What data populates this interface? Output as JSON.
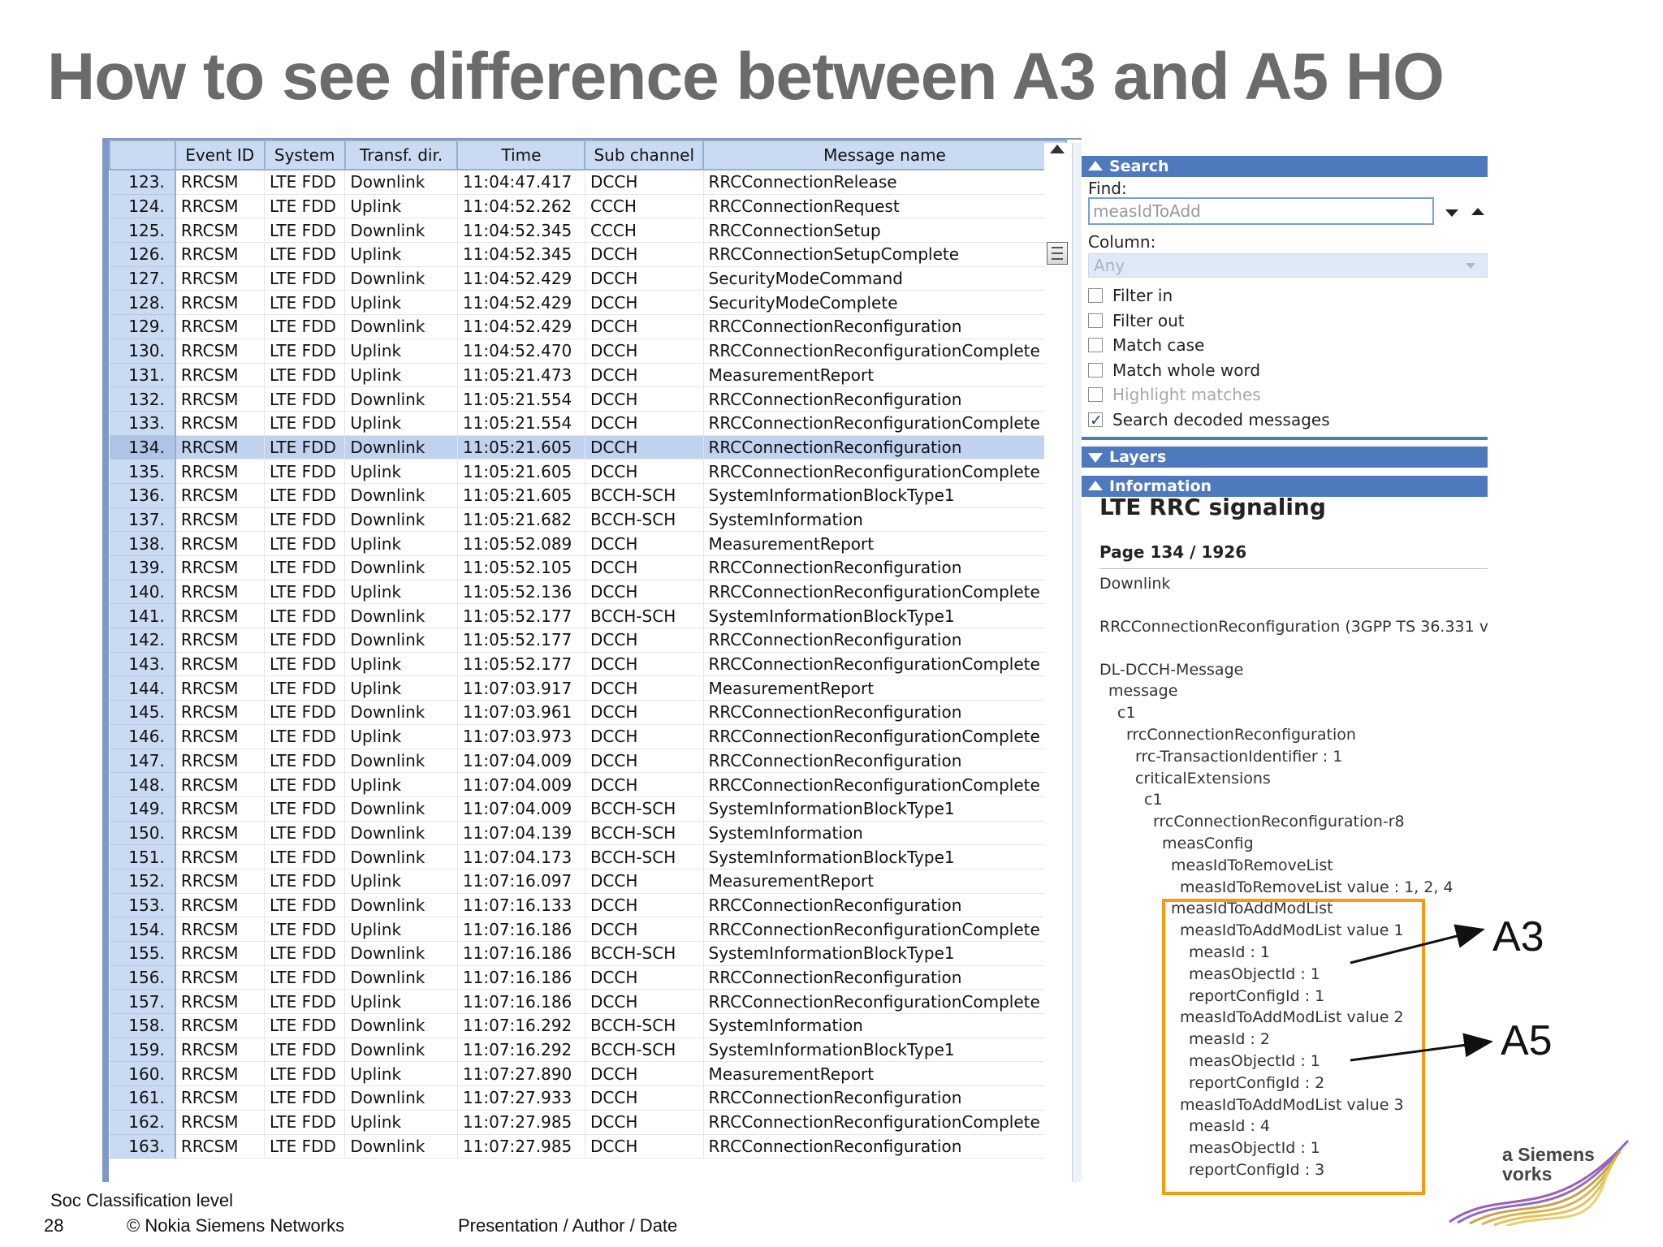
{
  "slide": {
    "title": "How to see difference between A3 and A5 HO",
    "footer_classification": "Soc Classification level",
    "footer_page": "28",
    "footer_copyright": "© Nokia Siemens Networks",
    "footer_meta": "Presentation / Author / Date",
    "logo_line1": "a Siemens",
    "logo_line2": "vorks"
  },
  "table": {
    "columns": [
      "Event ID",
      "System",
      "Transf. dir.",
      "Time",
      "Sub channel",
      "Message name"
    ],
    "selected_row": "134.",
    "rows": [
      [
        "123.",
        "RRCSM",
        "LTE FDD",
        "Downlink",
        "11:04:47.417",
        "DCCH",
        "RRCConnectionRelease"
      ],
      [
        "124.",
        "RRCSM",
        "LTE FDD",
        "Uplink",
        "11:04:52.262",
        "CCCH",
        "RRCConnectionRequest"
      ],
      [
        "125.",
        "RRCSM",
        "LTE FDD",
        "Downlink",
        "11:04:52.345",
        "CCCH",
        "RRCConnectionSetup"
      ],
      [
        "126.",
        "RRCSM",
        "LTE FDD",
        "Uplink",
        "11:04:52.345",
        "DCCH",
        "RRCConnectionSetupComplete"
      ],
      [
        "127.",
        "RRCSM",
        "LTE FDD",
        "Downlink",
        "11:04:52.429",
        "DCCH",
        "SecurityModeCommand"
      ],
      [
        "128.",
        "RRCSM",
        "LTE FDD",
        "Uplink",
        "11:04:52.429",
        "DCCH",
        "SecurityModeComplete"
      ],
      [
        "129.",
        "RRCSM",
        "LTE FDD",
        "Downlink",
        "11:04:52.429",
        "DCCH",
        "RRCConnectionReconfiguration"
      ],
      [
        "130.",
        "RRCSM",
        "LTE FDD",
        "Uplink",
        "11:04:52.470",
        "DCCH",
        "RRCConnectionReconfigurationComplete"
      ],
      [
        "131.",
        "RRCSM",
        "LTE FDD",
        "Uplink",
        "11:05:21.473",
        "DCCH",
        "MeasurementReport"
      ],
      [
        "132.",
        "RRCSM",
        "LTE FDD",
        "Downlink",
        "11:05:21.554",
        "DCCH",
        "RRCConnectionReconfiguration"
      ],
      [
        "133.",
        "RRCSM",
        "LTE FDD",
        "Uplink",
        "11:05:21.554",
        "DCCH",
        "RRCConnectionReconfigurationComplete"
      ],
      [
        "134.",
        "RRCSM",
        "LTE FDD",
        "Downlink",
        "11:05:21.605",
        "DCCH",
        "RRCConnectionReconfiguration"
      ],
      [
        "135.",
        "RRCSM",
        "LTE FDD",
        "Uplink",
        "11:05:21.605",
        "DCCH",
        "RRCConnectionReconfigurationComplete"
      ],
      [
        "136.",
        "RRCSM",
        "LTE FDD",
        "Downlink",
        "11:05:21.605",
        "BCCH-SCH",
        "SystemInformationBlockType1"
      ],
      [
        "137.",
        "RRCSM",
        "LTE FDD",
        "Downlink",
        "11:05:21.682",
        "BCCH-SCH",
        "SystemInformation"
      ],
      [
        "138.",
        "RRCSM",
        "LTE FDD",
        "Uplink",
        "11:05:52.089",
        "DCCH",
        "MeasurementReport"
      ],
      [
        "139.",
        "RRCSM",
        "LTE FDD",
        "Downlink",
        "11:05:52.105",
        "DCCH",
        "RRCConnectionReconfiguration"
      ],
      [
        "140.",
        "RRCSM",
        "LTE FDD",
        "Uplink",
        "11:05:52.136",
        "DCCH",
        "RRCConnectionReconfigurationComplete"
      ],
      [
        "141.",
        "RRCSM",
        "LTE FDD",
        "Downlink",
        "11:05:52.177",
        "BCCH-SCH",
        "SystemInformationBlockType1"
      ],
      [
        "142.",
        "RRCSM",
        "LTE FDD",
        "Downlink",
        "11:05:52.177",
        "DCCH",
        "RRCConnectionReconfiguration"
      ],
      [
        "143.",
        "RRCSM",
        "LTE FDD",
        "Uplink",
        "11:05:52.177",
        "DCCH",
        "RRCConnectionReconfigurationComplete"
      ],
      [
        "144.",
        "RRCSM",
        "LTE FDD",
        "Uplink",
        "11:07:03.917",
        "DCCH",
        "MeasurementReport"
      ],
      [
        "145.",
        "RRCSM",
        "LTE FDD",
        "Downlink",
        "11:07:03.961",
        "DCCH",
        "RRCConnectionReconfiguration"
      ],
      [
        "146.",
        "RRCSM",
        "LTE FDD",
        "Uplink",
        "11:07:03.973",
        "DCCH",
        "RRCConnectionReconfigurationComplete"
      ],
      [
        "147.",
        "RRCSM",
        "LTE FDD",
        "Downlink",
        "11:07:04.009",
        "DCCH",
        "RRCConnectionReconfiguration"
      ],
      [
        "148.",
        "RRCSM",
        "LTE FDD",
        "Uplink",
        "11:07:04.009",
        "DCCH",
        "RRCConnectionReconfigurationComplete"
      ],
      [
        "149.",
        "RRCSM",
        "LTE FDD",
        "Downlink",
        "11:07:04.009",
        "BCCH-SCH",
        "SystemInformationBlockType1"
      ],
      [
        "150.",
        "RRCSM",
        "LTE FDD",
        "Downlink",
        "11:07:04.139",
        "BCCH-SCH",
        "SystemInformation"
      ],
      [
        "151.",
        "RRCSM",
        "LTE FDD",
        "Downlink",
        "11:07:04.173",
        "BCCH-SCH",
        "SystemInformationBlockType1"
      ],
      [
        "152.",
        "RRCSM",
        "LTE FDD",
        "Uplink",
        "11:07:16.097",
        "DCCH",
        "MeasurementReport"
      ],
      [
        "153.",
        "RRCSM",
        "LTE FDD",
        "Downlink",
        "11:07:16.133",
        "DCCH",
        "RRCConnectionReconfiguration"
      ],
      [
        "154.",
        "RRCSM",
        "LTE FDD",
        "Uplink",
        "11:07:16.186",
        "DCCH",
        "RRCConnectionReconfigurationComplete"
      ],
      [
        "155.",
        "RRCSM",
        "LTE FDD",
        "Downlink",
        "11:07:16.186",
        "BCCH-SCH",
        "SystemInformationBlockType1"
      ],
      [
        "156.",
        "RRCSM",
        "LTE FDD",
        "Downlink",
        "11:07:16.186",
        "DCCH",
        "RRCConnectionReconfiguration"
      ],
      [
        "157.",
        "RRCSM",
        "LTE FDD",
        "Uplink",
        "11:07:16.186",
        "DCCH",
        "RRCConnectionReconfigurationComplete"
      ],
      [
        "158.",
        "RRCSM",
        "LTE FDD",
        "Downlink",
        "11:07:16.292",
        "BCCH-SCH",
        "SystemInformation"
      ],
      [
        "159.",
        "RRCSM",
        "LTE FDD",
        "Downlink",
        "11:07:16.292",
        "BCCH-SCH",
        "SystemInformationBlockType1"
      ],
      [
        "160.",
        "RRCSM",
        "LTE FDD",
        "Uplink",
        "11:07:27.890",
        "DCCH",
        "MeasurementReport"
      ],
      [
        "161.",
        "RRCSM",
        "LTE FDD",
        "Downlink",
        "11:07:27.933",
        "DCCH",
        "RRCConnectionReconfiguration"
      ],
      [
        "162.",
        "RRCSM",
        "LTE FDD",
        "Uplink",
        "11:07:27.985",
        "DCCH",
        "RRCConnectionReconfigurationComplete"
      ],
      [
        "163.",
        "RRCSM",
        "LTE FDD",
        "Downlink",
        "11:07:27.985",
        "DCCH",
        "RRCConnectionReconfiguration"
      ]
    ]
  },
  "search_panel": {
    "header": "Search",
    "find_label": "Find:",
    "find_value": "measIdToAdd",
    "column_label": "Column:",
    "column_value": "Any",
    "options": [
      {
        "label": "Filter in",
        "checked": false,
        "disabled": false
      },
      {
        "label": "Filter out",
        "checked": false,
        "disabled": false
      },
      {
        "label": "Match case",
        "checked": false,
        "disabled": false
      },
      {
        "label": "Match whole word",
        "checked": false,
        "disabled": false
      },
      {
        "label": "Highlight matches",
        "checked": false,
        "disabled": true
      },
      {
        "label": "Search decoded messages",
        "checked": true,
        "disabled": false
      }
    ]
  },
  "layers_panel": {
    "header": "Layers"
  },
  "information_panel": {
    "header": "Information",
    "title": "LTE RRC signaling",
    "page": "Page 134 / 1926",
    "tree": [
      {
        "text": "Downlink",
        "indent": 0,
        "gap": 0
      },
      {
        "text": "RRCConnectionReconfiguration     (3GPP TS 36.331 v",
        "indent": 0,
        "gap": 1
      },
      {
        "text": "DL-DCCH-Message",
        "indent": 0,
        "gap": 1
      },
      {
        "text": "message",
        "indent": 1,
        "gap": 0
      },
      {
        "text": "c1",
        "indent": 2,
        "gap": 0
      },
      {
        "text": "rrcConnectionReconfiguration",
        "indent": 3,
        "gap": 0
      },
      {
        "text": "rrc-TransactionIdentifier     : 1",
        "indent": 4,
        "gap": 0
      },
      {
        "text": "criticalExtensions",
        "indent": 4,
        "gap": 0
      },
      {
        "text": "c1",
        "indent": 5,
        "gap": 0
      },
      {
        "text": "rrcConnectionReconfiguration-r8",
        "indent": 6,
        "gap": 0
      },
      {
        "text": "measConfig",
        "indent": 7,
        "gap": 0
      },
      {
        "text": "measIdToRemoveList",
        "indent": 8,
        "gap": 0
      },
      {
        "text": "measIdToRemoveList value     : 1, 2, 4",
        "indent": 9,
        "gap": 0
      },
      {
        "text": "measIdToAddModList",
        "indent": 8,
        "gap": 0
      },
      {
        "text": "measIdToAddModList value 1",
        "indent": 9,
        "gap": 0
      },
      {
        "text": "measId     : 1",
        "indent": 10,
        "gap": 0
      },
      {
        "text": "measObjectId     : 1",
        "indent": 10,
        "gap": 0
      },
      {
        "text": "reportConfigId     : 1",
        "indent": 10,
        "gap": 0
      },
      {
        "text": "measIdToAddModList value 2",
        "indent": 9,
        "gap": 0
      },
      {
        "text": "measId     : 2",
        "indent": 10,
        "gap": 0
      },
      {
        "text": "measObjectId     : 1",
        "indent": 10,
        "gap": 0
      },
      {
        "text": "reportConfigId     : 2",
        "indent": 10,
        "gap": 0
      },
      {
        "text": "measIdToAddModList value 3",
        "indent": 9,
        "gap": 0
      },
      {
        "text": "measId     : 4",
        "indent": 10,
        "gap": 0
      },
      {
        "text": "measObjectId     : 1",
        "indent": 10,
        "gap": 0
      },
      {
        "text": "reportConfigId     : 3",
        "indent": 10,
        "gap": 0
      }
    ]
  },
  "callouts": {
    "a3": "A3",
    "a5": "A5",
    "highlight_color": "#f39c12"
  },
  "icons": [
    "scroll-up-arrow-icon",
    "scroll-thumb-icon",
    "find-next-icon",
    "find-previous-icon",
    "dropdown-arrow-icon",
    "collapse-icon",
    "expand-icon",
    "checkbox-icon",
    "arrow-icon"
  ]
}
